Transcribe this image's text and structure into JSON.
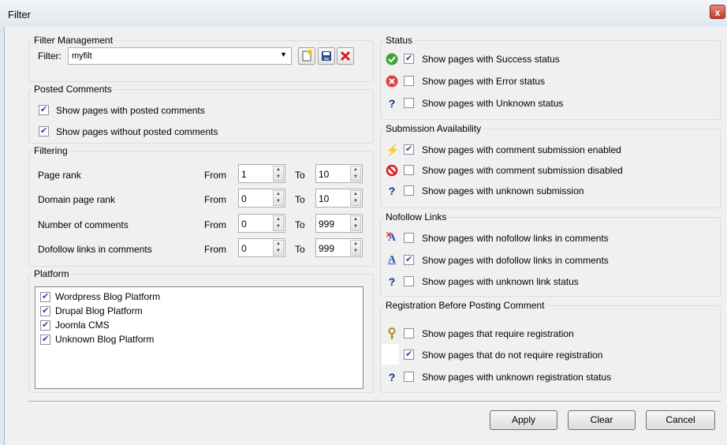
{
  "window": {
    "title": "Filter",
    "close_glyph": "x"
  },
  "filter_management": {
    "legend": "Filter Management",
    "filter_label": "Filter:",
    "filter_value": "myfilt",
    "icons": [
      "new-filter-icon",
      "save-icon",
      "delete-icon"
    ]
  },
  "posted_comments": {
    "legend": "Posted Comments",
    "items": [
      {
        "label": "Show pages with posted comments",
        "checked": true
      },
      {
        "label": "Show pages without posted comments",
        "checked": true
      }
    ]
  },
  "filtering": {
    "legend": "Filtering",
    "from_label": "From",
    "to_label": "To",
    "rows": [
      {
        "label": "Page rank",
        "from": "1",
        "to": "10"
      },
      {
        "label": "Domain page rank",
        "from": "0",
        "to": "10"
      },
      {
        "label": "Number of comments",
        "from": "0",
        "to": "999"
      },
      {
        "label": "Dofollow links in comments",
        "from": "0",
        "to": "999"
      }
    ]
  },
  "platform": {
    "legend": "Platform",
    "items": [
      {
        "label": "Wordpress Blog Platform",
        "checked": true
      },
      {
        "label": "Drupal Blog Platform",
        "checked": true
      },
      {
        "label": "Joomla CMS",
        "checked": true
      },
      {
        "label": "Unknown Blog Platform",
        "checked": true
      }
    ]
  },
  "status": {
    "legend": "Status",
    "items": [
      {
        "label": "Show pages with Success status",
        "checked": true,
        "icon": "success-icon"
      },
      {
        "label": "Show pages with Error status",
        "checked": false,
        "icon": "error-icon"
      },
      {
        "label": "Show pages with Unknown status",
        "checked": false,
        "icon": "question-icon"
      }
    ]
  },
  "submission": {
    "legend": "Submission Availability",
    "items": [
      {
        "label": "Show pages with comment submission enabled",
        "checked": true,
        "icon": "lightning-icon"
      },
      {
        "label": "Show pages with comment submission disabled",
        "checked": false,
        "icon": "no-entry-icon"
      },
      {
        "label": "Show pages with unknown submission",
        "checked": false,
        "icon": "question-icon"
      }
    ]
  },
  "nofollow": {
    "legend": "Nofollow Links",
    "items": [
      {
        "label": "Show pages with nofollow links in comments",
        "checked": false,
        "icon": "nofollow-link-icon"
      },
      {
        "label": "Show pages with dofollow links in comments",
        "checked": true,
        "icon": "dofollow-link-icon"
      },
      {
        "label": "Show pages with unknown link status",
        "checked": false,
        "icon": "question-icon"
      }
    ]
  },
  "registration": {
    "legend": "Registration Before Posting Comment",
    "items": [
      {
        "label": "Show pages that require registration",
        "checked": false,
        "icon": "key-icon"
      },
      {
        "label": "Show pages that do not require registration",
        "checked": true,
        "icon": "blank-icon"
      },
      {
        "label": "Show pages with unknown registration status",
        "checked": false,
        "icon": "question-icon"
      }
    ]
  },
  "buttons": {
    "apply": "Apply",
    "clear": "Clear",
    "cancel": "Cancel"
  }
}
